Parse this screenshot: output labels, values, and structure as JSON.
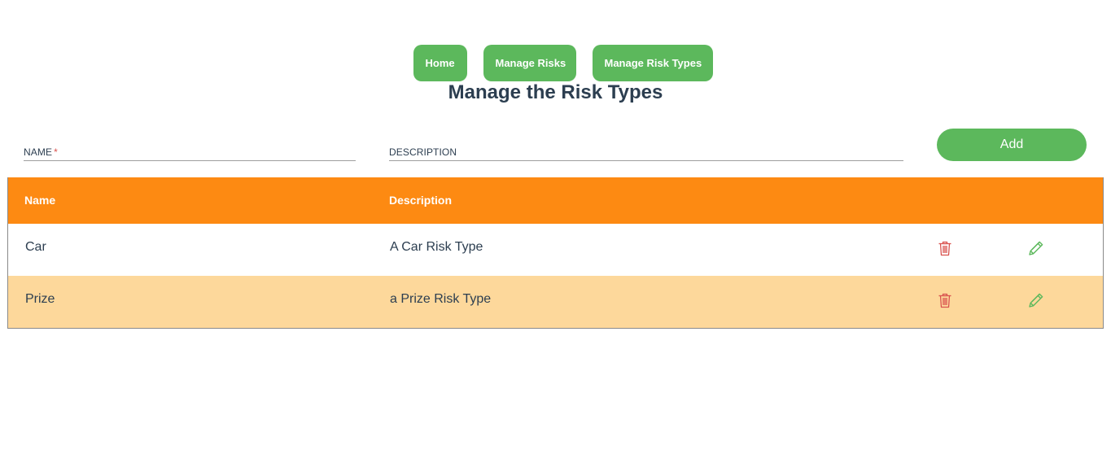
{
  "nav": {
    "items": [
      {
        "label": "Home"
      },
      {
        "label": "Manage Risks"
      },
      {
        "label": "Manage Risk Types"
      }
    ]
  },
  "page": {
    "title": "Manage the Risk Types"
  },
  "form": {
    "name_label": "NAME",
    "name_required_marker": "*",
    "name_value": "",
    "description_label": "DESCRIPTION",
    "description_value": "",
    "add_label": "Add"
  },
  "table": {
    "columns": [
      "Name",
      "Description"
    ],
    "rows": [
      {
        "name": "Car",
        "description": "A Car Risk Type",
        "delete_icon": "trash-icon",
        "edit_icon": "pencil-icon"
      },
      {
        "name": "Prize",
        "description": "a Prize Risk Type",
        "delete_icon": "trash-icon",
        "edit_icon": "pencil-icon"
      }
    ]
  },
  "colors": {
    "button_green": "#5cb85c",
    "header_orange": "#fd8a12",
    "row_alt": "#fdd89b",
    "delete_red": "#d9534f",
    "edit_green": "#5cb85c",
    "text_dark": "#2c3e50"
  }
}
